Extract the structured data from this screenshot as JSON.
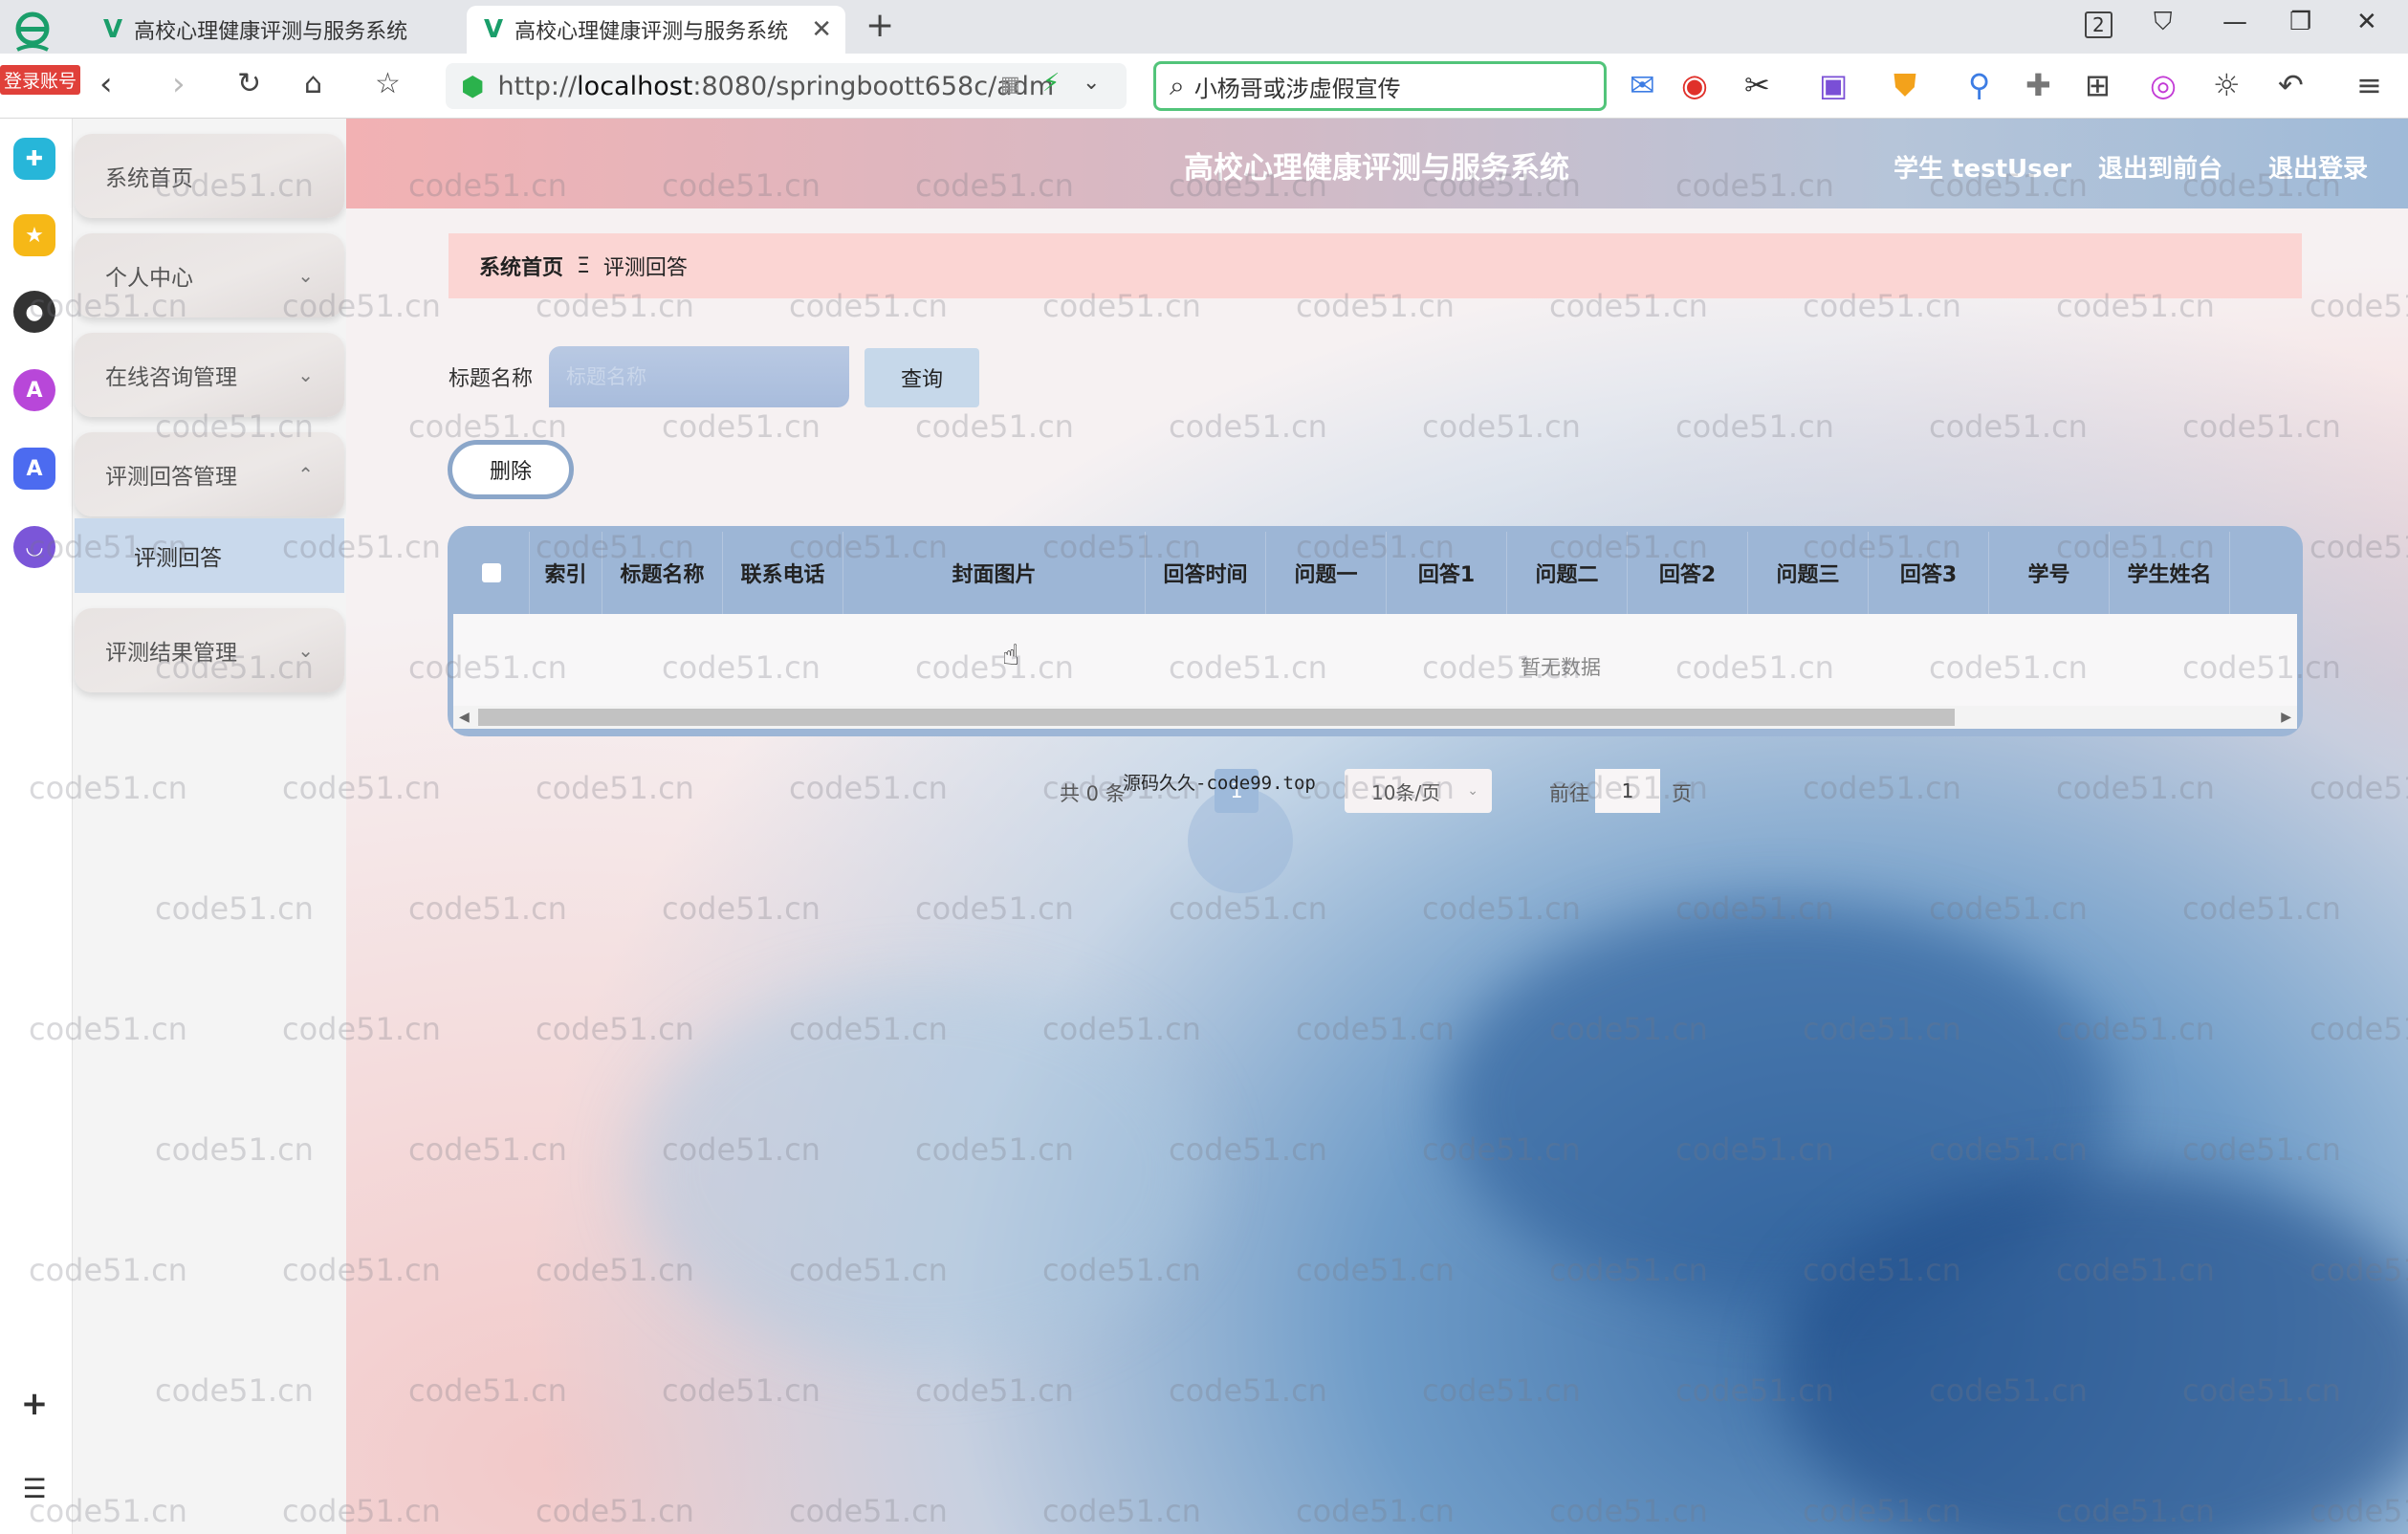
{
  "browser": {
    "login_badge": "登录账号",
    "tabs": [
      {
        "title": "高校心理健康评测与服务系统"
      },
      {
        "title": "高校心理健康评测与服务系统"
      }
    ],
    "url_host": "localhost",
    "url_rest": ":8080/springboott658c/adm",
    "search_text": "小杨哥或涉虚假宣传",
    "window_count": "2"
  },
  "app": {
    "title": "高校心理健康评测与服务系统",
    "user_label": "学生 testUser",
    "front_link": "退出到前台",
    "logout_link": "退出登录"
  },
  "sidebar": {
    "items": [
      {
        "label": "系统首页"
      },
      {
        "label": "个人中心"
      },
      {
        "label": "在线咨询管理"
      },
      {
        "label": "评测回答管理"
      },
      {
        "label": "评测结果管理"
      }
    ],
    "active_sub": "评测回答"
  },
  "breadcrumb": {
    "home": "系统首页",
    "sep": "Ξ",
    "current": "评测回答"
  },
  "search": {
    "label": "标题名称",
    "placeholder": "标题名称",
    "query_btn": "查询"
  },
  "actions": {
    "delete_btn": "删除"
  },
  "table": {
    "columns": [
      "索引",
      "标题名称",
      "联系电话",
      "封面图片",
      "回答时间",
      "问题一",
      "回答1",
      "问题二",
      "回答2",
      "问题三",
      "回答3",
      "学号",
      "学生姓名"
    ],
    "empty_text": "暂无数据"
  },
  "pagination": {
    "total": "共 0 条",
    "site_label": "源码久久-code99.top",
    "current_page": "1",
    "page_size": "10条/页",
    "goto_label": "前往",
    "goto_value": "1",
    "page_unit": "页"
  },
  "watermark": "code51.cn"
}
